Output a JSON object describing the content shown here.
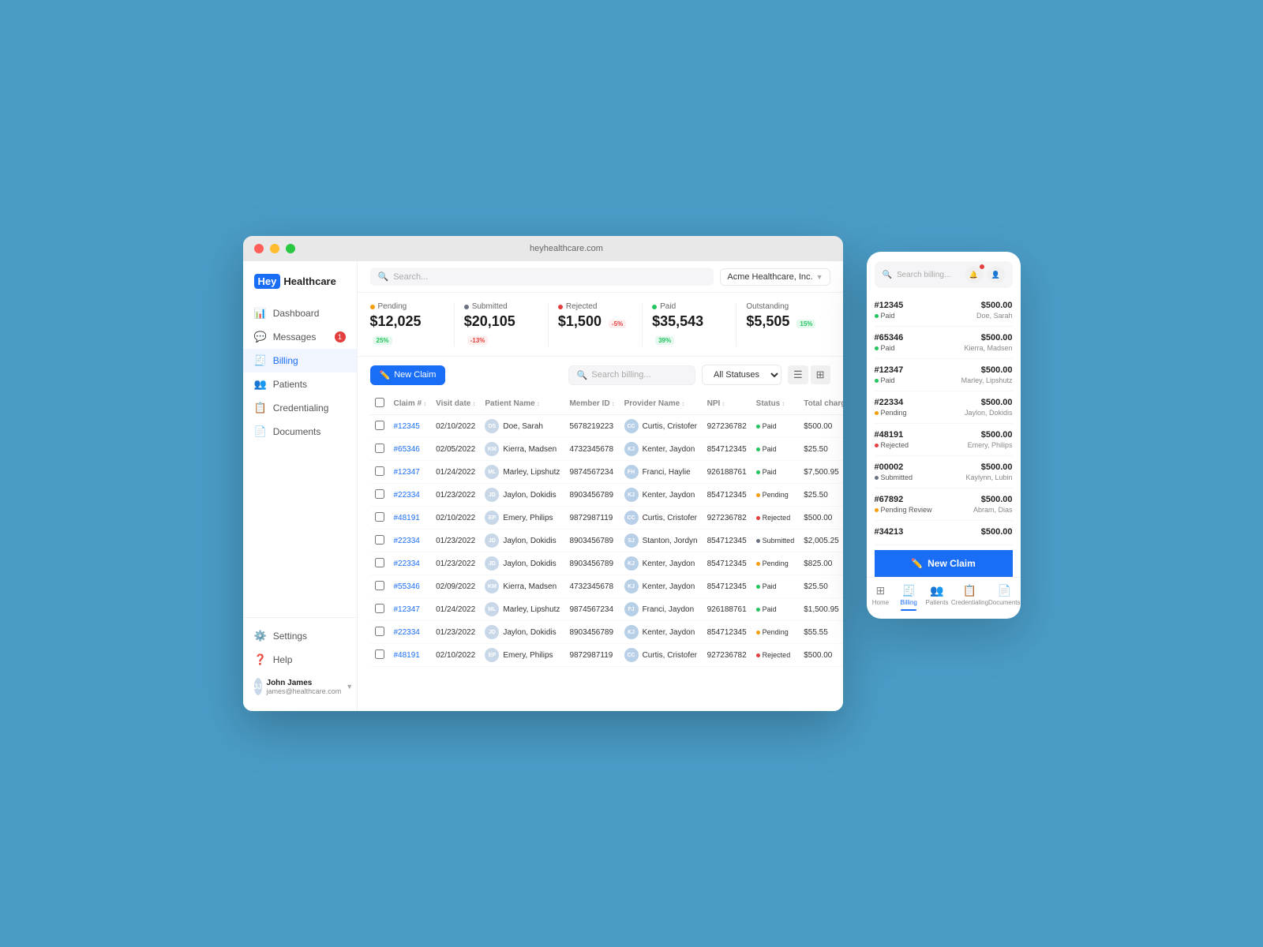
{
  "browser": {
    "url": "heyhealthcare.com"
  },
  "logo": {
    "hey": "Hey",
    "healthcare": "Healthcare"
  },
  "nav": {
    "items": [
      {
        "label": "Dashboard",
        "icon": "📊",
        "active": false,
        "badge": null
      },
      {
        "label": "Messages",
        "icon": "💬",
        "active": false,
        "badge": "1"
      },
      {
        "label": "Billing",
        "icon": "🧾",
        "active": true,
        "badge": null
      },
      {
        "label": "Patients",
        "icon": "👥",
        "active": false,
        "badge": null
      },
      {
        "label": "Credentialing",
        "icon": "📋",
        "active": false,
        "badge": null
      },
      {
        "label": "Documents",
        "icon": "📄",
        "active": false,
        "badge": null
      }
    ],
    "settings": "Settings",
    "help": "Help"
  },
  "user": {
    "name": "John James",
    "email": "james@healthcare.com"
  },
  "topbar": {
    "search_placeholder": "Search...",
    "org": "Acme Healthcare, Inc."
  },
  "stats": [
    {
      "label": "Pending",
      "color": "#f59e0b",
      "value": "$12,025",
      "badge": "25%",
      "trend": "up"
    },
    {
      "label": "Submitted",
      "color": "#6b7280",
      "value": "$20,105",
      "badge": "-13%",
      "trend": "down"
    },
    {
      "label": "Rejected",
      "color": "#e53e3e",
      "value": "$1,500",
      "badge": "-5%",
      "trend": "down"
    },
    {
      "label": "Paid",
      "color": "#22c55e",
      "value": "$35,543",
      "badge": "39%",
      "trend": "up"
    },
    {
      "label": "Outstanding",
      "color": "#1a6ef5",
      "value": "$5,505",
      "badge": "15%",
      "trend": "up"
    }
  ],
  "toolbar": {
    "new_claim": "New Claim",
    "search_placeholder": "Search billing...",
    "status_filter": "All Statuses"
  },
  "table": {
    "columns": [
      "Claim #",
      "Visit date",
      "Patient Name",
      "Member ID",
      "Provider Name",
      "NPI",
      "Status",
      "Total charge"
    ],
    "rows": [
      {
        "claim": "#12345",
        "visit_date": "02/10/2022",
        "patient": "Doe, Sarah",
        "member_id": "5678219223",
        "provider": "Curtis, Cristofer",
        "npi": "927236782",
        "status": "Paid",
        "status_type": "paid",
        "charge": "$500.00"
      },
      {
        "claim": "#65346",
        "visit_date": "02/05/2022",
        "patient": "Kierra, Madsen",
        "member_id": "4732345678",
        "provider": "Kenter, Jaydon",
        "npi": "854712345",
        "status": "Paid",
        "status_type": "paid",
        "charge": "$25.50"
      },
      {
        "claim": "#12347",
        "visit_date": "01/24/2022",
        "patient": "Marley, Lipshutz",
        "member_id": "9874567234",
        "provider": "Franci, Haylie",
        "npi": "926188761",
        "status": "Paid",
        "status_type": "paid",
        "charge": "$7,500.95"
      },
      {
        "claim": "#22334",
        "visit_date": "01/23/2022",
        "patient": "Jaylon, Dokidis",
        "member_id": "8903456789",
        "provider": "Kenter, Jaydon",
        "npi": "854712345",
        "status": "Pending",
        "status_type": "pending",
        "charge": "$25.50"
      },
      {
        "claim": "#48191",
        "visit_date": "02/10/2022",
        "patient": "Emery, Philips",
        "member_id": "9872987119",
        "provider": "Curtis, Cristofer",
        "npi": "927236782",
        "status": "Rejected",
        "status_type": "rejected",
        "charge": "$500.00"
      },
      {
        "claim": "#22334",
        "visit_date": "01/23/2022",
        "patient": "Jaylon, Dokidis",
        "member_id": "8903456789",
        "provider": "Stanton, Jordyn",
        "npi": "854712345",
        "status": "Submitted",
        "status_type": "submitted",
        "charge": "$2,005.25"
      },
      {
        "claim": "#22334",
        "visit_date": "01/23/2022",
        "patient": "Jaylon, Dokidis",
        "member_id": "8903456789",
        "provider": "Kenter, Jaydon",
        "npi": "854712345",
        "status": "Pending",
        "status_type": "pending",
        "charge": "$825.00"
      },
      {
        "claim": "#55346",
        "visit_date": "02/09/2022",
        "patient": "Kierra, Madsen",
        "member_id": "4732345678",
        "provider": "Kenter, Jaydon",
        "npi": "854712345",
        "status": "Paid",
        "status_type": "paid",
        "charge": "$25.50"
      },
      {
        "claim": "#12347",
        "visit_date": "01/24/2022",
        "patient": "Marley, Lipshutz",
        "member_id": "9874567234",
        "provider": "Franci, Jaydon",
        "npi": "926188761",
        "status": "Paid",
        "status_type": "paid",
        "charge": "$1,500.95"
      },
      {
        "claim": "#22334",
        "visit_date": "01/23/2022",
        "patient": "Jaylon, Dokidis",
        "member_id": "8903456789",
        "provider": "Kenter, Jaydon",
        "npi": "854712345",
        "status": "Pending",
        "status_type": "pending",
        "charge": "$55.55"
      },
      {
        "claim": "#48191",
        "visit_date": "02/10/2022",
        "patient": "Emery, Philips",
        "member_id": "9872987119",
        "provider": "Curtis, Cristofer",
        "npi": "927236782",
        "status": "Rejected",
        "status_type": "rejected",
        "charge": "$500.00"
      }
    ]
  },
  "mobile": {
    "search_placeholder": "Search billing...",
    "billing_items": [
      {
        "id": "#12345",
        "amount": "$500.00",
        "status": "Paid",
        "status_type": "paid",
        "patient": "Doe, Sarah"
      },
      {
        "id": "#65346",
        "amount": "$500.00",
        "status": "Paid",
        "status_type": "paid",
        "patient": "Kierra, Madsen"
      },
      {
        "id": "#12347",
        "amount": "$500.00",
        "status": "Paid",
        "status_type": "paid",
        "patient": "Marley, Lipshutz"
      },
      {
        "id": "#22334",
        "amount": "$500.00",
        "status": "Pending",
        "status_type": "pending",
        "patient": "Jaylon, Dokidis"
      },
      {
        "id": "#48191",
        "amount": "$500.00",
        "status": "Rejected",
        "status_type": "rejected",
        "patient": "Emery, Philips"
      },
      {
        "id": "#00002",
        "amount": "$500.00",
        "status": "Submitted",
        "status_type": "submitted",
        "patient": "Kaylynn, Lubin"
      },
      {
        "id": "#67892",
        "amount": "$500.00",
        "status": "Pending Review",
        "status_type": "pending",
        "patient": "Abram, Dias"
      },
      {
        "id": "#34213",
        "amount": "$500.00",
        "status": "",
        "status_type": "",
        "patient": ""
      }
    ],
    "new_claim": "New Claim",
    "nav_items": [
      {
        "label": "Home",
        "icon": "⊞",
        "active": false
      },
      {
        "label": "Billing",
        "icon": "🧾",
        "active": true
      },
      {
        "label": "Patients",
        "icon": "👥",
        "active": false
      },
      {
        "label": "Credentialing",
        "icon": "📋",
        "active": false
      },
      {
        "label": "Documents",
        "icon": "📄",
        "active": false
      }
    ]
  }
}
